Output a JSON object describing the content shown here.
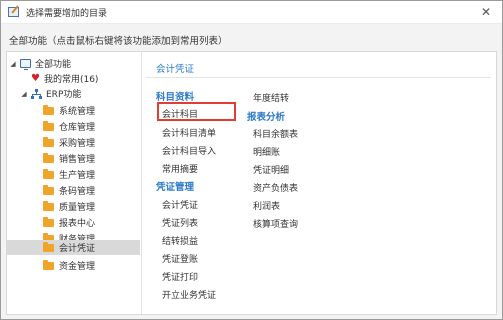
{
  "window": {
    "title": "选择需要增加的目录",
    "close_symbol": "✕"
  },
  "hint": "全部功能（点击鼠标右键将该功能添加到常用列表）",
  "tree": {
    "root": "全部功能",
    "favorites": "我的常用(16)",
    "erp": "ERP功能",
    "modules": [
      "系统管理",
      "仓库管理",
      "采购管理",
      "销售管理",
      "生产管理",
      "条码管理",
      "质量管理",
      "报表中心",
      "财务管理",
      "会计凭证",
      "资金管理"
    ],
    "selected": "会计凭证"
  },
  "content": {
    "section_title": "会计凭证",
    "groups": {
      "subject_data": {
        "title": "科目资料",
        "items": [
          "会计科目",
          "会计科目清单",
          "会计科目导入",
          "常用摘要"
        ]
      },
      "voucher_mgmt": {
        "title": "凭证管理",
        "items": [
          "会计凭证",
          "凭证列表",
          "结转损益",
          "凭证登账",
          "凭证打印",
          "开立业务凭证"
        ]
      },
      "year_end": {
        "items": [
          "年度结转"
        ]
      },
      "report_analysis": {
        "title": "报表分析",
        "items": [
          "科目余额表",
          "明细账",
          "凭证明细",
          "资产负债表",
          "利润表",
          "核算项查询"
        ]
      }
    },
    "highlighted_item": "会计科目"
  }
}
